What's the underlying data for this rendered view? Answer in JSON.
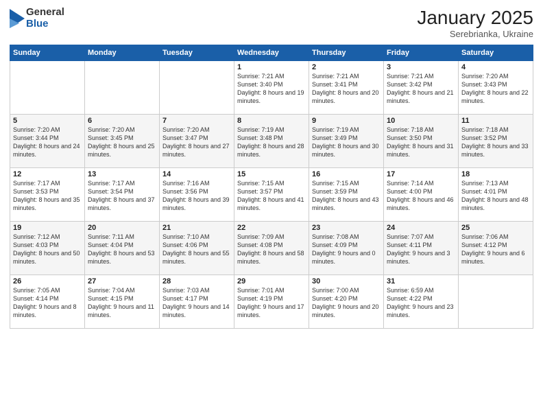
{
  "header": {
    "logo_general": "General",
    "logo_blue": "Blue",
    "month": "January 2025",
    "location": "Serebrianka, Ukraine"
  },
  "weekdays": [
    "Sunday",
    "Monday",
    "Tuesday",
    "Wednesday",
    "Thursday",
    "Friday",
    "Saturday"
  ],
  "weeks": [
    [
      {
        "day": "",
        "info": ""
      },
      {
        "day": "",
        "info": ""
      },
      {
        "day": "",
        "info": ""
      },
      {
        "day": "1",
        "info": "Sunrise: 7:21 AM\nSunset: 3:40 PM\nDaylight: 8 hours\nand 19 minutes."
      },
      {
        "day": "2",
        "info": "Sunrise: 7:21 AM\nSunset: 3:41 PM\nDaylight: 8 hours\nand 20 minutes."
      },
      {
        "day": "3",
        "info": "Sunrise: 7:21 AM\nSunset: 3:42 PM\nDaylight: 8 hours\nand 21 minutes."
      },
      {
        "day": "4",
        "info": "Sunrise: 7:20 AM\nSunset: 3:43 PM\nDaylight: 8 hours\nand 22 minutes."
      }
    ],
    [
      {
        "day": "5",
        "info": "Sunrise: 7:20 AM\nSunset: 3:44 PM\nDaylight: 8 hours\nand 24 minutes."
      },
      {
        "day": "6",
        "info": "Sunrise: 7:20 AM\nSunset: 3:45 PM\nDaylight: 8 hours\nand 25 minutes."
      },
      {
        "day": "7",
        "info": "Sunrise: 7:20 AM\nSunset: 3:47 PM\nDaylight: 8 hours\nand 27 minutes."
      },
      {
        "day": "8",
        "info": "Sunrise: 7:19 AM\nSunset: 3:48 PM\nDaylight: 8 hours\nand 28 minutes."
      },
      {
        "day": "9",
        "info": "Sunrise: 7:19 AM\nSunset: 3:49 PM\nDaylight: 8 hours\nand 30 minutes."
      },
      {
        "day": "10",
        "info": "Sunrise: 7:18 AM\nSunset: 3:50 PM\nDaylight: 8 hours\nand 31 minutes."
      },
      {
        "day": "11",
        "info": "Sunrise: 7:18 AM\nSunset: 3:52 PM\nDaylight: 8 hours\nand 33 minutes."
      }
    ],
    [
      {
        "day": "12",
        "info": "Sunrise: 7:17 AM\nSunset: 3:53 PM\nDaylight: 8 hours\nand 35 minutes."
      },
      {
        "day": "13",
        "info": "Sunrise: 7:17 AM\nSunset: 3:54 PM\nDaylight: 8 hours\nand 37 minutes."
      },
      {
        "day": "14",
        "info": "Sunrise: 7:16 AM\nSunset: 3:56 PM\nDaylight: 8 hours\nand 39 minutes."
      },
      {
        "day": "15",
        "info": "Sunrise: 7:15 AM\nSunset: 3:57 PM\nDaylight: 8 hours\nand 41 minutes."
      },
      {
        "day": "16",
        "info": "Sunrise: 7:15 AM\nSunset: 3:59 PM\nDaylight: 8 hours\nand 43 minutes."
      },
      {
        "day": "17",
        "info": "Sunrise: 7:14 AM\nSunset: 4:00 PM\nDaylight: 8 hours\nand 46 minutes."
      },
      {
        "day": "18",
        "info": "Sunrise: 7:13 AM\nSunset: 4:01 PM\nDaylight: 8 hours\nand 48 minutes."
      }
    ],
    [
      {
        "day": "19",
        "info": "Sunrise: 7:12 AM\nSunset: 4:03 PM\nDaylight: 8 hours\nand 50 minutes."
      },
      {
        "day": "20",
        "info": "Sunrise: 7:11 AM\nSunset: 4:04 PM\nDaylight: 8 hours\nand 53 minutes."
      },
      {
        "day": "21",
        "info": "Sunrise: 7:10 AM\nSunset: 4:06 PM\nDaylight: 8 hours\nand 55 minutes."
      },
      {
        "day": "22",
        "info": "Sunrise: 7:09 AM\nSunset: 4:08 PM\nDaylight: 8 hours\nand 58 minutes."
      },
      {
        "day": "23",
        "info": "Sunrise: 7:08 AM\nSunset: 4:09 PM\nDaylight: 9 hours\nand 0 minutes."
      },
      {
        "day": "24",
        "info": "Sunrise: 7:07 AM\nSunset: 4:11 PM\nDaylight: 9 hours\nand 3 minutes."
      },
      {
        "day": "25",
        "info": "Sunrise: 7:06 AM\nSunset: 4:12 PM\nDaylight: 9 hours\nand 6 minutes."
      }
    ],
    [
      {
        "day": "26",
        "info": "Sunrise: 7:05 AM\nSunset: 4:14 PM\nDaylight: 9 hours\nand 8 minutes."
      },
      {
        "day": "27",
        "info": "Sunrise: 7:04 AM\nSunset: 4:15 PM\nDaylight: 9 hours\nand 11 minutes."
      },
      {
        "day": "28",
        "info": "Sunrise: 7:03 AM\nSunset: 4:17 PM\nDaylight: 9 hours\nand 14 minutes."
      },
      {
        "day": "29",
        "info": "Sunrise: 7:01 AM\nSunset: 4:19 PM\nDaylight: 9 hours\nand 17 minutes."
      },
      {
        "day": "30",
        "info": "Sunrise: 7:00 AM\nSunset: 4:20 PM\nDaylight: 9 hours\nand 20 minutes."
      },
      {
        "day": "31",
        "info": "Sunrise: 6:59 AM\nSunset: 4:22 PM\nDaylight: 9 hours\nand 23 minutes."
      },
      {
        "day": "",
        "info": ""
      }
    ]
  ]
}
